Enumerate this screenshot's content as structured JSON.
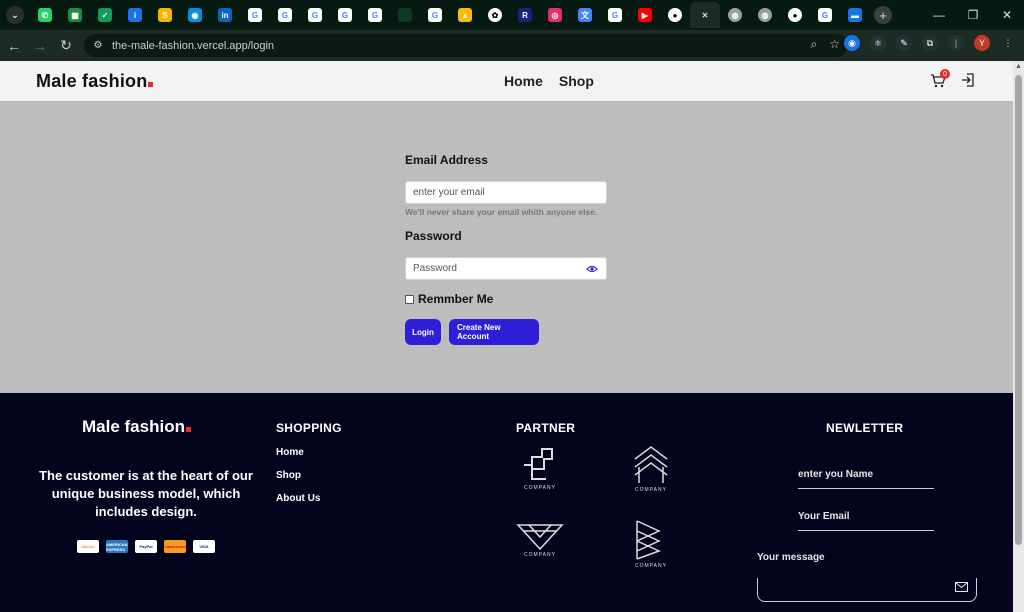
{
  "browser": {
    "url": "the-male-fashion.vercel.app/login",
    "profile_initial": "Y",
    "tab_favicons": [
      {
        "icon": "whatsapp-icon",
        "color": "#25d366",
        "glyph": "✆"
      },
      {
        "icon": "sheets-icon",
        "color": "#1e8e3e",
        "glyph": "▦"
      },
      {
        "icon": "site-icon",
        "color": "#0f9d58",
        "glyph": "✓"
      },
      {
        "icon": "info-icon",
        "color": "#1a73e8",
        "glyph": "i"
      },
      {
        "icon": "letter-s-icon",
        "color": "#f4b400",
        "glyph": "S"
      },
      {
        "icon": "browser-icon",
        "color": "#0b8fd8",
        "glyph": "◉"
      },
      {
        "icon": "linkedin-icon",
        "color": "#0a66c2",
        "glyph": "in"
      },
      {
        "icon": "google-icon",
        "color": "#ffffff",
        "glyph": "G"
      },
      {
        "icon": "google-icon",
        "color": "#ffffff",
        "glyph": "G"
      },
      {
        "icon": "google-icon",
        "color": "#ffffff",
        "glyph": "G"
      },
      {
        "icon": "google-icon",
        "color": "#ffffff",
        "glyph": "G"
      },
      {
        "icon": "google-icon",
        "color": "#ffffff",
        "glyph": "G"
      },
      {
        "icon": "blank-icon",
        "color": "#0d3a24",
        "glyph": ""
      },
      {
        "icon": "google-icon",
        "color": "#ffffff",
        "glyph": "G"
      },
      {
        "icon": "drive-icon",
        "color": "#fbbc04",
        "glyph": "▲"
      },
      {
        "icon": "openai-icon",
        "color": "#ffffff",
        "glyph": "✿"
      },
      {
        "icon": "letter-r-icon",
        "color": "#1a237e",
        "glyph": "R"
      },
      {
        "icon": "instagram-icon",
        "color": "#e1306c",
        "glyph": "◎"
      },
      {
        "icon": "translate-icon",
        "color": "#4285f4",
        "glyph": "文"
      },
      {
        "icon": "google-icon",
        "color": "#ffffff",
        "glyph": "G"
      },
      {
        "icon": "youtube-icon",
        "color": "#ff0000",
        "glyph": "▶"
      },
      {
        "icon": "github-icon",
        "color": "#ffffff",
        "glyph": "●"
      },
      {
        "icon": "close-icon",
        "color": "#1e2a24",
        "glyph": "✕"
      },
      {
        "icon": "globe-icon",
        "color": "#9aa19d",
        "glyph": "◍"
      },
      {
        "icon": "globe-icon",
        "color": "#9aa19d",
        "glyph": "◍"
      },
      {
        "icon": "github-icon",
        "color": "#ffffff",
        "glyph": "●"
      },
      {
        "icon": "google-icon",
        "color": "#ffffff",
        "glyph": "G"
      },
      {
        "icon": "app-icon",
        "color": "#1a73e8",
        "glyph": "▬"
      }
    ]
  },
  "header": {
    "logo": "Male fashion",
    "nav": [
      "Home",
      "Shop"
    ],
    "cart_count": "0"
  },
  "form": {
    "email_label": "Email Address",
    "email_placeholder": "enter your email",
    "email_help": "We'll never share your email whith anyone else.",
    "password_label": "Password",
    "password_placeholder": "Password",
    "remember_label": "Remmber Me",
    "login_button": "Login",
    "create_button": "Create New Account"
  },
  "footer": {
    "logo": "Male fashion",
    "description": "The customer is at the heart of our unique business model, which includes design.",
    "payments": [
      "bitcoin",
      "AMERICAN EXPRESS",
      "PayPal",
      "mastercard",
      "VISA"
    ],
    "shopping_heading": "SHOPPING",
    "shopping_links": [
      "Home",
      "Shop",
      "About Us"
    ],
    "partner_heading": "PARTNER",
    "partner_label": "COMPANY",
    "newsletter_heading": "NEWLETTER",
    "name_placeholder": "enter you Name",
    "email_placeholder": "Your Email",
    "message_placeholder": "Your message"
  },
  "colors": {
    "accent": "#2d1fd6",
    "brand_dot": "#e52d27",
    "footer_bg": "#03041e",
    "page_bg": "#bdbdbd"
  }
}
